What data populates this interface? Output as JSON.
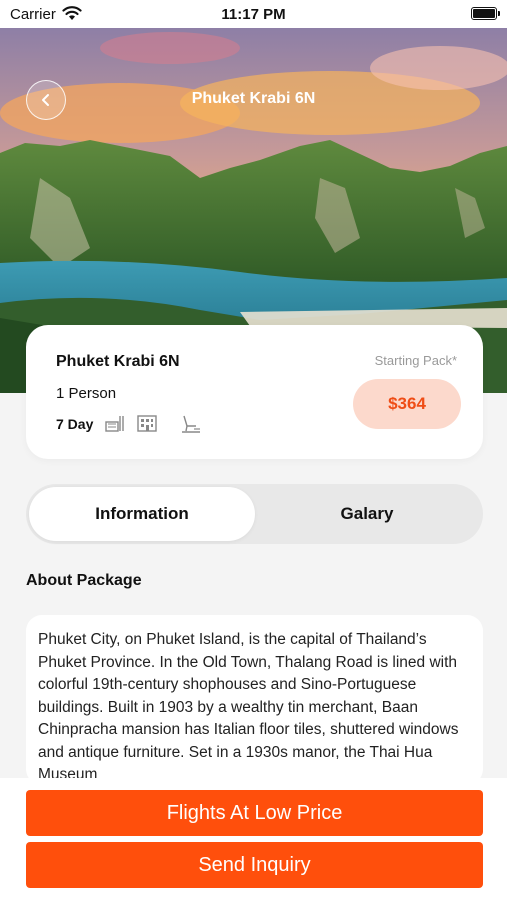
{
  "status_bar": {
    "carrier": "Carrier",
    "time": "11:17 PM"
  },
  "header": {
    "title": "Phuket Krabi 6N"
  },
  "package": {
    "name": "Phuket Krabi 6N",
    "persons": "1 Person",
    "days": "7 Day",
    "amenities": [
      "meal-icon",
      "hotel-icon",
      "transfer-icon"
    ],
    "starting_label": "Starting Pack*",
    "price": "$364"
  },
  "tabs": [
    {
      "label": "Information",
      "active": true
    },
    {
      "label": "Galary",
      "active": false
    }
  ],
  "about": {
    "title": "About Package",
    "text": "Phuket City, on Phuket Island, is the capital of Thailand’s Phuket Province. In the Old Town, Thalang Road is lined with colorful 19th-century shophouses and Sino-Portuguese buildings. Built in 1903 by a wealthy tin merchant, Baan Chinpracha mansion has Italian floor tiles, shuttered windows and antique furniture. Set in a 1930s manor, the Thai Hua Museum"
  },
  "actions": {
    "flights_label": "Flights At Low Price",
    "inquiry_label": "Send Inquiry"
  },
  "colors": {
    "accent": "#ff4f0c",
    "price_text": "#ef4d16",
    "price_bg": "#fcd9cc"
  }
}
